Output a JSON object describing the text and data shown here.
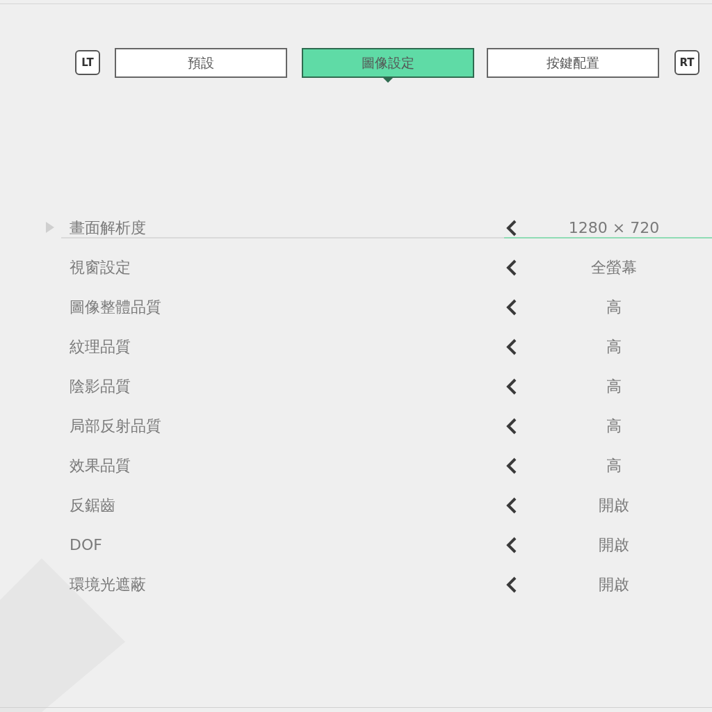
{
  "tabs_bar": {
    "left_key": "LT",
    "right_key": "RT",
    "tabs": [
      {
        "label": "預設",
        "selected": false
      },
      {
        "label": "圖像設定",
        "selected": true
      },
      {
        "label": "按鍵配置",
        "selected": false
      }
    ]
  },
  "settings": [
    {
      "label": "畫面解析度",
      "value": "1280 × 720",
      "selected": true
    },
    {
      "label": "視窗設定",
      "value": "全螢幕",
      "selected": false
    },
    {
      "label": "圖像整體品質",
      "value": "高",
      "selected": false
    },
    {
      "label": "紋理品質",
      "value": "高",
      "selected": false
    },
    {
      "label": "陰影品質",
      "value": "高",
      "selected": false
    },
    {
      "label": "局部反射品質",
      "value": "高",
      "selected": false
    },
    {
      "label": "效果品質",
      "value": "高",
      "selected": false
    },
    {
      "label": "反鋸齒",
      "value": "開啟",
      "selected": false
    },
    {
      "label": "DOF",
      "value": "開啟",
      "selected": false
    },
    {
      "label": "環境光遮蔽",
      "value": "開啟",
      "selected": false
    }
  ]
}
